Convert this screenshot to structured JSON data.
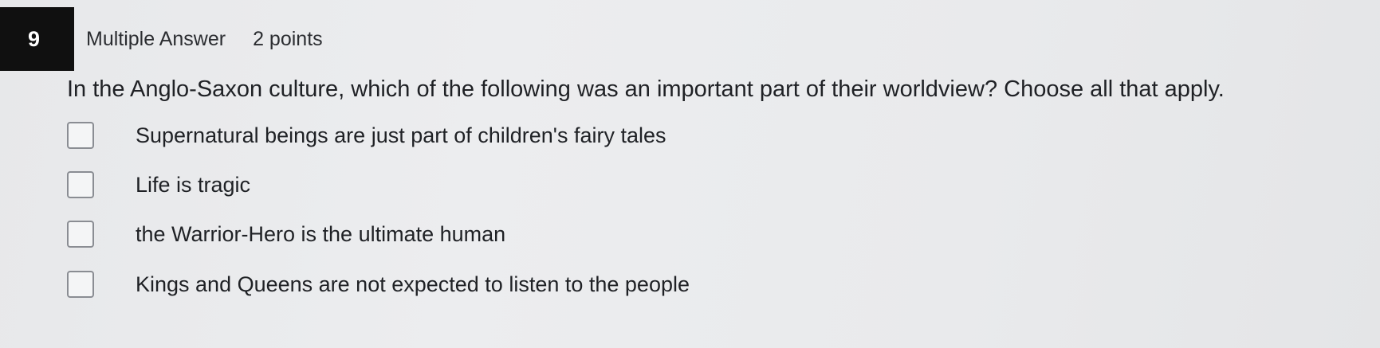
{
  "question": {
    "number": "9",
    "type": "Multiple Answer",
    "points": "2 points",
    "prompt": "In the Anglo-Saxon culture, which of the following was an important part of their worldview? Choose all that apply."
  },
  "options": [
    {
      "label": "Supernatural beings are just part of children's fairy tales",
      "checked": false
    },
    {
      "label": "Life is tragic",
      "checked": false
    },
    {
      "label": "the Warrior-Hero is the ultimate human",
      "checked": false
    },
    {
      "label": "Kings and Queens are not expected to listen to the people",
      "checked": false
    }
  ]
}
